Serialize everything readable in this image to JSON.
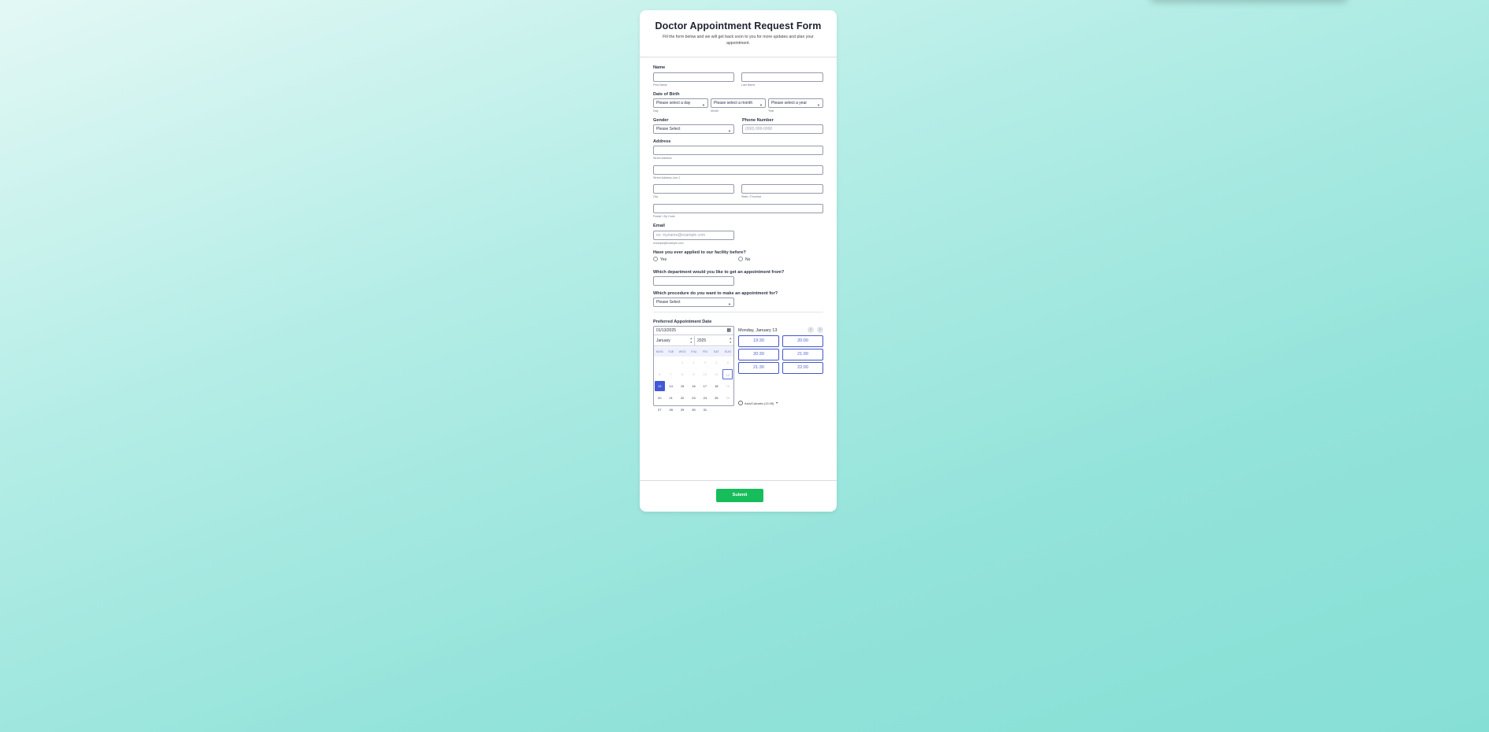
{
  "header": {
    "title": "Doctor Appointment Request Form",
    "subtitle": "Fill the form below and we will get back soon to you for more updates and plan your appointment."
  },
  "name": {
    "label": "Name",
    "first_sub": "First Name",
    "last_sub": "Last Name"
  },
  "dob": {
    "label": "Date of Birth",
    "day_value": "Please select a day",
    "month_value": "Please select a month",
    "year_value": "Please select a year",
    "day_sub": "Day",
    "month_sub": "Month",
    "year_sub": "Year"
  },
  "gender": {
    "label": "Gender",
    "value": "Please Select"
  },
  "phone": {
    "label": "Phone Number",
    "placeholder": "(000) 000-0000"
  },
  "address": {
    "label": "Address",
    "street_sub": "Street Address",
    "street2_sub": "Street Address Line 2",
    "city_sub": "City",
    "state_sub": "State / Province",
    "zip_sub": "Postal / Zip Code"
  },
  "email": {
    "label": "Email",
    "placeholder": "ex: myname@example.com",
    "sub": "example@example.com"
  },
  "applied": {
    "label": "Have you ever applied to our facility before?",
    "yes": "Yes",
    "no": "No"
  },
  "department": {
    "label": "Which department would you like to get an appointment from?"
  },
  "procedure": {
    "label": "Which procedure do you want to make an appointment for?",
    "value": "Please Select"
  },
  "appointment": {
    "label": "Preferred Appointment Date",
    "date_value": "01/13/2025",
    "month_value": "January",
    "year_value": "2025",
    "weekdays": [
      "MON",
      "TUE",
      "WED",
      "THU",
      "FRI",
      "SAT",
      "SUN"
    ],
    "weeks": [
      [
        "",
        "",
        "1",
        "2",
        "3",
        "4",
        "5"
      ],
      [
        "6",
        "7",
        "8",
        "9",
        "10",
        "11",
        "12"
      ],
      [
        "13",
        "14",
        "15",
        "16",
        "17",
        "18",
        "19"
      ],
      [
        "20",
        "21",
        "22",
        "23",
        "24",
        "25",
        "26"
      ],
      [
        "27",
        "28",
        "29",
        "30",
        "31",
        "",
        ""
      ]
    ],
    "selected_day": "13",
    "today_day": "12",
    "dim_days": [
      "1",
      "2",
      "3",
      "4",
      "5",
      "6",
      "7",
      "8",
      "9",
      "10",
      "11",
      "12",
      "19",
      "26"
    ],
    "day_heading": "Monday, January 13",
    "slots": [
      "19:30",
      "20:00",
      "20:30",
      "21:00",
      "21:30",
      "22:00"
    ],
    "timezone": "Asia/Calcutta (13:28)",
    "prev_icon": "‹",
    "next_icon": "›"
  },
  "submit": {
    "label": "Submit"
  },
  "colors": {
    "accent": "#4358d8",
    "submit": "#18bd5b"
  }
}
